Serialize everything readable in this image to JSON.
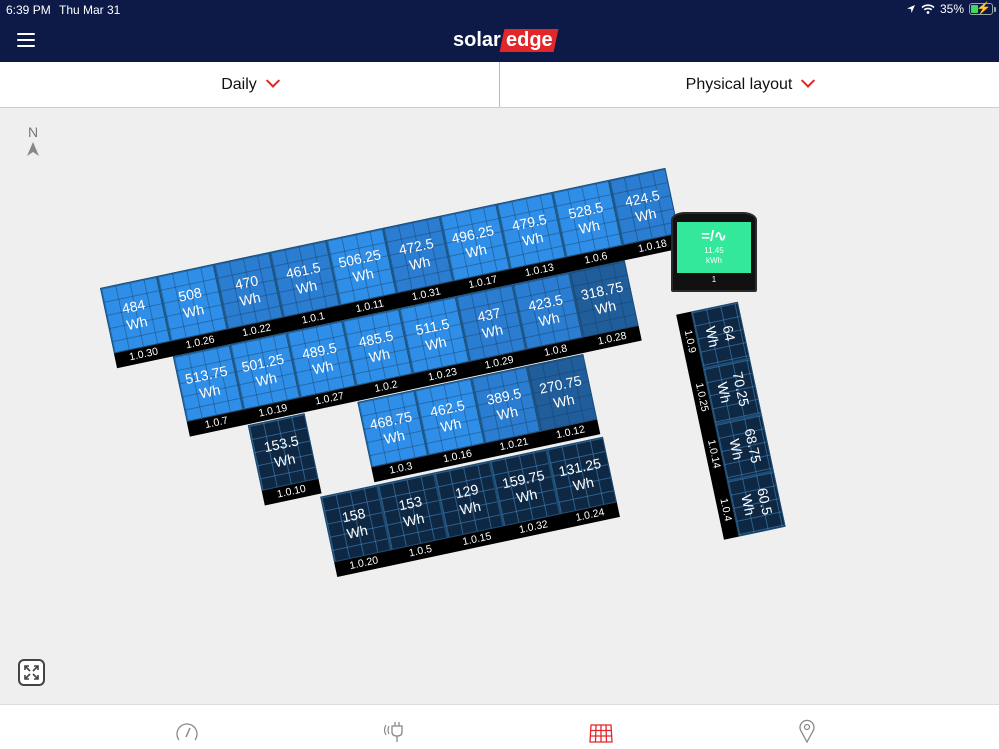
{
  "status_bar": {
    "time": "6:39 PM",
    "date": "Thu Mar 31",
    "battery_percent": "35%",
    "battery_level": 0.35,
    "charging": true
  },
  "header": {
    "logo_part1": "solar",
    "logo_part2": "edge",
    "brand_color": "#e3262a",
    "nav_color": "#0d1a47"
  },
  "selectors": {
    "period": "Daily",
    "view": "Physical layout"
  },
  "compass": {
    "label": "N"
  },
  "unit": "Wh",
  "colors": {
    "high": "#2f8fe8",
    "mid": "#2a7dd0",
    "low": "#1f5d9b",
    "dark": "#0e2742"
  },
  "arrays": [
    {
      "name": "row-1",
      "panels": [
        {
          "value": "484",
          "id": "1.0.30",
          "tier": "high"
        },
        {
          "value": "508",
          "id": "1.0.26",
          "tier": "high"
        },
        {
          "value": "470",
          "id": "1.0.22",
          "tier": "mid"
        },
        {
          "value": "461.5",
          "id": "1.0.1",
          "tier": "mid"
        },
        {
          "value": "506.25",
          "id": "1.0.11",
          "tier": "high"
        },
        {
          "value": "472.5",
          "id": "1.0.31",
          "tier": "mid"
        },
        {
          "value": "496.25",
          "id": "1.0.17",
          "tier": "high"
        },
        {
          "value": "479.5",
          "id": "1.0.13",
          "tier": "high"
        },
        {
          "value": "528.5",
          "id": "1.0.6",
          "tier": "high"
        },
        {
          "value": "424.5",
          "id": "1.0.18",
          "tier": "mid"
        }
      ]
    },
    {
      "name": "row-2",
      "panels": [
        {
          "value": "513.75",
          "id": "1.0.7",
          "tier": "high"
        },
        {
          "value": "501.25",
          "id": "1.0.19",
          "tier": "high"
        },
        {
          "value": "489.5",
          "id": "1.0.27",
          "tier": "high"
        },
        {
          "value": "485.5",
          "id": "1.0.2",
          "tier": "high"
        },
        {
          "value": "511.5",
          "id": "1.0.23",
          "tier": "high"
        },
        {
          "value": "437",
          "id": "1.0.29",
          "tier": "mid"
        },
        {
          "value": "423.5",
          "id": "1.0.8",
          "tier": "mid"
        },
        {
          "value": "318.75",
          "id": "1.0.28",
          "tier": "low"
        }
      ]
    },
    {
      "name": "row-3-single",
      "panels": [
        {
          "value": "153.5",
          "id": "1.0.10",
          "tier": "dark"
        }
      ]
    },
    {
      "name": "row-3",
      "panels": [
        {
          "value": "468.75",
          "id": "1.0.3",
          "tier": "high"
        },
        {
          "value": "462.5",
          "id": "1.0.16",
          "tier": "high"
        },
        {
          "value": "389.5",
          "id": "1.0.21",
          "tier": "mid"
        },
        {
          "value": "270.75",
          "id": "1.0.12",
          "tier": "low"
        }
      ]
    },
    {
      "name": "row-4",
      "panels": [
        {
          "value": "158",
          "id": "1.0.20",
          "tier": "dark"
        },
        {
          "value": "153",
          "id": "1.0.5",
          "tier": "dark"
        },
        {
          "value": "129",
          "id": "1.0.15",
          "tier": "dark"
        },
        {
          "value": "159.75",
          "id": "1.0.32",
          "tier": "dark"
        },
        {
          "value": "131.25",
          "id": "1.0.24",
          "tier": "dark"
        }
      ]
    }
  ],
  "vertical_string": {
    "panels": [
      {
        "value": "64",
        "id": "1.0.9",
        "tier": "dark"
      },
      {
        "value": "70.25",
        "id": "1.0.25",
        "tier": "dark"
      },
      {
        "value": "68.75",
        "id": "1.0.14",
        "tier": "dark"
      },
      {
        "value": "60.5",
        "id": "1.0.4",
        "tier": "dark"
      }
    ]
  },
  "inverter": {
    "symbol": "=/∿",
    "energy_value": "11.45",
    "energy_unit": "kWh",
    "id": "1",
    "screen_color": "#33e89a"
  },
  "tabs": [
    {
      "name": "dashboard",
      "active": false
    },
    {
      "name": "power-flow",
      "active": false
    },
    {
      "name": "layout",
      "active": true
    },
    {
      "name": "site-location",
      "active": false
    }
  ],
  "active_tab_color": "#e3262a",
  "inactive_tab_color": "#888888"
}
